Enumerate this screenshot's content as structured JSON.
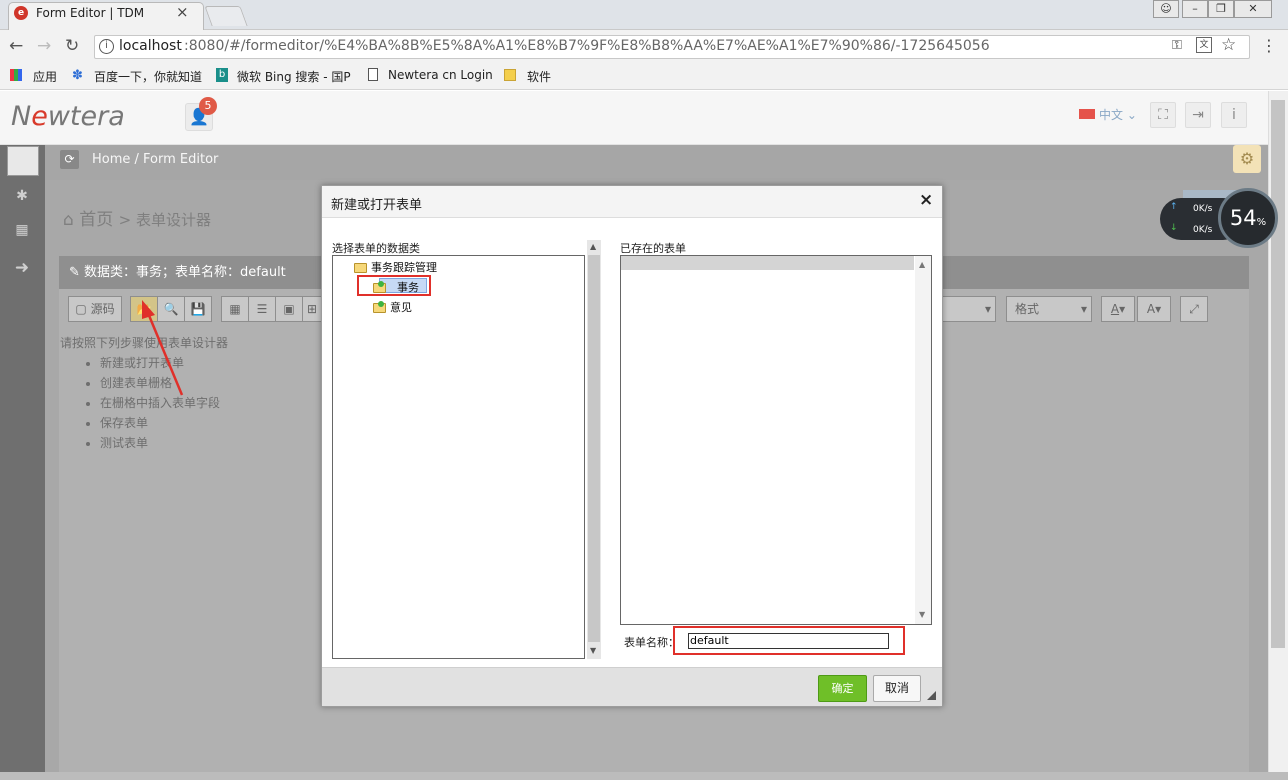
{
  "browser": {
    "tab_title": "Form Editor | TDM",
    "tab_close": "×",
    "url_host": "localhost",
    "url_path": ":8080/#/formeditor/%E4%BA%8B%E5%8A%A1%E8%B7%9F%E8%B8%AA%E7%AE%A1%E7%90%86/-1725645056",
    "bookmarks": [
      "应用",
      "百度一下，你就知道",
      "微软 Bing 搜索 - 国P",
      "Newtera cn Login",
      "软件"
    ]
  },
  "app": {
    "logo_pre": "N",
    "logo_mark": "e",
    "logo_post": "wtera",
    "notification_count": "5",
    "language": "中文",
    "breadcrumb": "Home /  Form Editor",
    "page_title": "首页",
    "page_subtitle": "> 表单设计器",
    "panel_title": "数据类：事务；表单名称：default",
    "toolbar": {
      "source_label": "源码",
      "format_label": "格式",
      "font_color": "A",
      "bg_color": "A"
    },
    "instructions": {
      "intro": "请按照下列步骤使用表单设计器",
      "steps": [
        "新建或打开表单",
        "创建表单栅格",
        "在栅格中插入表单字段",
        "保存表单",
        "测试表单"
      ]
    },
    "speed": {
      "up": "0K/s",
      "down": "0K/s",
      "percent": "54",
      "percent_unit": "%"
    }
  },
  "dialog": {
    "title": "新建或打开表单",
    "close": "×",
    "left_label": "选择表单的数据类",
    "tree": {
      "root": "事务跟踪管理",
      "children": [
        "事务",
        "意见"
      ],
      "selected": "事务"
    },
    "right_label": "已存在的表单",
    "existing_forms": [],
    "name_label": "表单名称：",
    "name_value": "default",
    "ok_label": "确定",
    "cancel_label": "取消"
  },
  "colors": {
    "accent_red": "#e0302a",
    "ok_green": "#6fbf28",
    "selection_blue": "#c6d9f5"
  }
}
